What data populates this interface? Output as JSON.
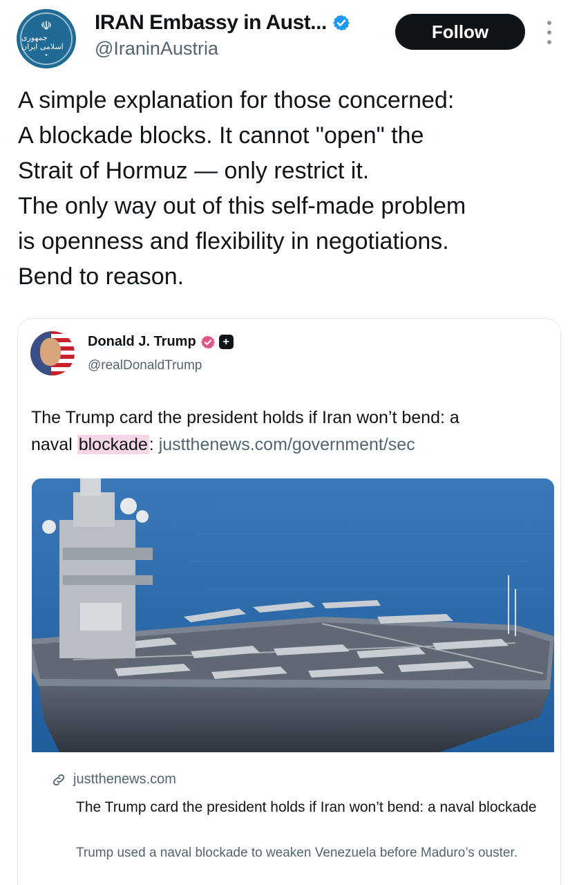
{
  "colors": {
    "text": "#0f1419",
    "secondary": "#536471",
    "verified_blue": "#1d9bf0",
    "verified_pink": "#e0558a",
    "follow_bg": "#0f1419",
    "highlight": "#f7d6e6"
  },
  "header": {
    "display_name": "IRAN Embassy in Aust...",
    "handle": "@IraninAustria",
    "verified_icon": "verified-check-icon",
    "follow_label": "Follow",
    "more_icon": "more-vertical-icon",
    "avatar_script": "جمهوری اسلامی ایران"
  },
  "tweet": {
    "lines": [
      "A simple explanation for those concerned:",
      "A blockade blocks. It cannot \"open\" the",
      "Strait of Hormuz — only restrict it.",
      "The only way out of this self-made problem",
      "is openness and flexibility in negotiations.",
      "Bend to reason."
    ]
  },
  "quote": {
    "display_name": "Donald J. Trump",
    "handle": "@realDonaldTrump",
    "badge_icon": "plus-badge-icon",
    "text_line1": "The Trump card the president holds if Iran won’t bend: a",
    "text_line2_pre": "naval ",
    "text_line2_highlight": "blockade",
    "text_line2_post": ": ",
    "text_link": "justthenews.com/government/sec",
    "image_alt_icon": "aircraft-carrier-image",
    "card": {
      "link_icon": "link-icon",
      "domain": "justthenews.com",
      "title": "The Trump card the president holds if Iran won’t bend: a naval blockade",
      "description": "Trump used a naval blockade to weaken Venezuela before Maduro’s ouster."
    }
  }
}
